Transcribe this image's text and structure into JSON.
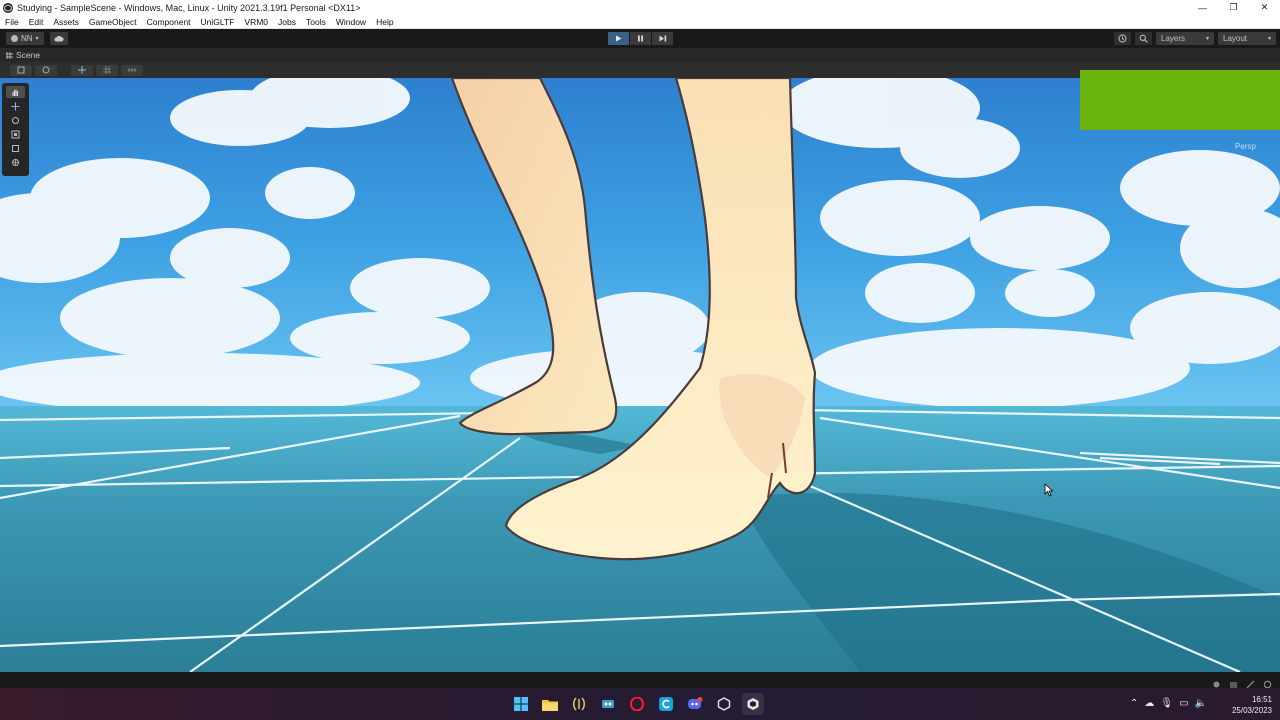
{
  "window": {
    "title": "Studying - SampleScene - Windows, Mac, Linux - Unity 2021.3.19f1 Personal <DX11>",
    "controls": [
      "—",
      "❐",
      "✕"
    ]
  },
  "menu": [
    "File",
    "Edit",
    "Assets",
    "GameObject",
    "Component",
    "UniGLTF",
    "VRM0",
    "Jobs",
    "Tools",
    "Window",
    "Help"
  ],
  "toolbar": {
    "account_label": "NN",
    "layers_label": "Layers",
    "layout_label": "Layout"
  },
  "scene_tab": {
    "label": "Scene"
  },
  "viewport": {
    "projection_label": "Persp",
    "gizmo_color": "#6cb40e"
  },
  "taskbar": {
    "apps": [
      "start-icon",
      "file-explorer-icon",
      "app-icon",
      "vscode-icon",
      "opera-icon",
      "c-app-icon",
      "discord-icon",
      "unity-hub-icon",
      "unity-icon"
    ],
    "clock_time": "16:51",
    "clock_date": "25/03/2023"
  }
}
